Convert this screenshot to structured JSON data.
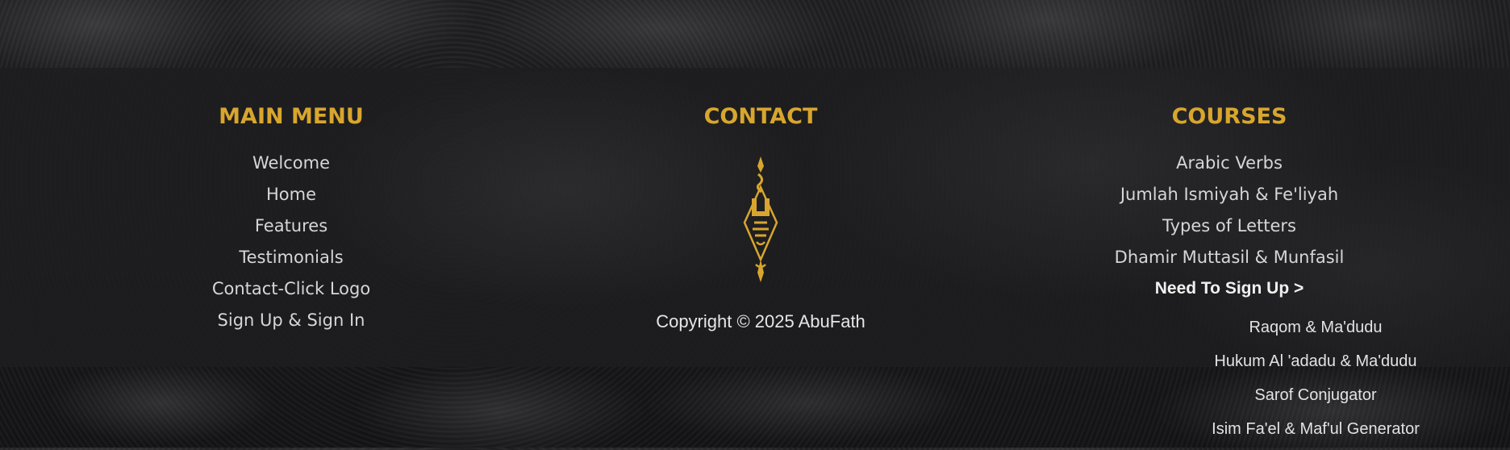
{
  "main_menu": {
    "title": "MAIN MENU",
    "items": [
      {
        "label": "Welcome"
      },
      {
        "label": "Home"
      },
      {
        "label": "Features"
      },
      {
        "label": "Testimonials"
      },
      {
        "label": "Contact-Click Logo"
      },
      {
        "label": "Sign Up & Sign In"
      }
    ]
  },
  "contact": {
    "title": "CONTACT",
    "logo_icon": "abufath-arabic-calligraphy-logo",
    "copyright": "Copyright © 2025 AbuFath"
  },
  "courses": {
    "title": "COURSES",
    "items": [
      {
        "label": "Arabic Verbs"
      },
      {
        "label": "Jumlah Ismiyah & Fe'liyah"
      },
      {
        "label": "Types of Letters"
      },
      {
        "label": "Dhamir Muttasil & Munfasil"
      }
    ],
    "signup_label": "Need To Sign Up >",
    "signup_items": [
      {
        "label": "Raqom & Ma'dudu"
      },
      {
        "label": "Hukum Al 'adadu & Ma'dudu"
      },
      {
        "label": "Sarof Conjugator"
      },
      {
        "label": "Isim Fa'el & Maf'ul Generator"
      }
    ]
  },
  "colors": {
    "accent_gold": "#d8a62e",
    "text_light": "#d6d6d6",
    "band_bg": "#1e1e20"
  }
}
